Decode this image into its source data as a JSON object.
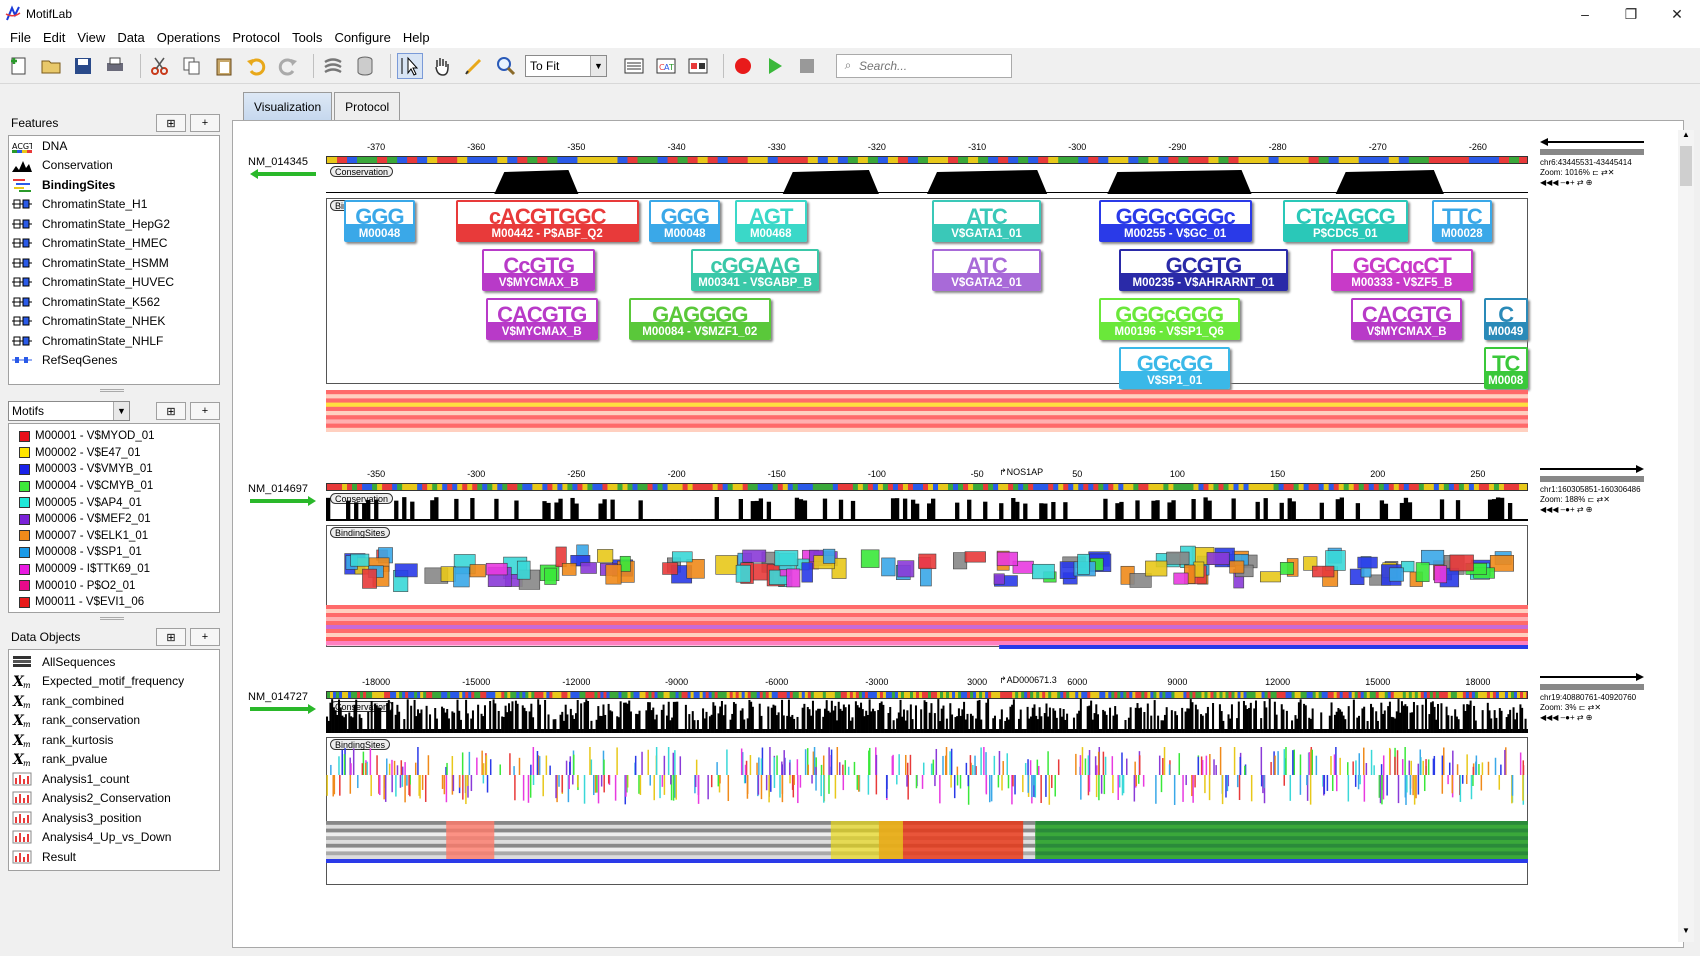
{
  "window": {
    "title": "MotifLab",
    "controls": [
      "–",
      "❐",
      "✕"
    ]
  },
  "menu": [
    "File",
    "Edit",
    "View",
    "Data",
    "Operations",
    "Protocol",
    "Tools",
    "Configure",
    "Help"
  ],
  "toolbar": {
    "zoom_value": "To Fit",
    "search_placeholder": "Search..."
  },
  "features": {
    "title": "Features",
    "items": [
      {
        "label": "DNA",
        "icon": "dna-icon",
        "bold": false
      },
      {
        "label": "Conservation",
        "icon": "conservation-icon",
        "bold": false
      },
      {
        "label": "BindingSites",
        "icon": "bindingsites-icon",
        "bold": true
      },
      {
        "label": "ChromatinState_H1",
        "icon": "region-icon",
        "bold": false
      },
      {
        "label": "ChromatinState_HepG2",
        "icon": "region-icon",
        "bold": false
      },
      {
        "label": "ChromatinState_HMEC",
        "icon": "region-icon",
        "bold": false
      },
      {
        "label": "ChromatinState_HSMM",
        "icon": "region-icon",
        "bold": false
      },
      {
        "label": "ChromatinState_HUVEC",
        "icon": "region-icon",
        "bold": false
      },
      {
        "label": "ChromatinState_K562",
        "icon": "region-icon",
        "bold": false
      },
      {
        "label": "ChromatinState_NHEK",
        "icon": "region-icon",
        "bold": false
      },
      {
        "label": "ChromatinState_NHLF",
        "icon": "region-icon",
        "bold": false
      },
      {
        "label": "RefSeqGenes",
        "icon": "genes-icon",
        "bold": false
      }
    ]
  },
  "motifs": {
    "selector": "Motifs",
    "items": [
      {
        "label": "M00001 - V$MYOD_01",
        "color": "#e8101a"
      },
      {
        "label": "M00002 - V$E47_01",
        "color": "#ffe600"
      },
      {
        "label": "M00003 - V$VMYB_01",
        "color": "#1a22e8"
      },
      {
        "label": "M00004 - V$CMYB_01",
        "color": "#3ee83a"
      },
      {
        "label": "M00005 - V$AP4_01",
        "color": "#1ee8d8"
      },
      {
        "label": "M00006 - V$MEF2_01",
        "color": "#7a22d8"
      },
      {
        "label": "M00007 - V$ELK1_01",
        "color": "#f08a1a"
      },
      {
        "label": "M00008 - V$SP1_01",
        "color": "#1a9ae8"
      },
      {
        "label": "M00009 - I$TTK69_01",
        "color": "#e81ae0"
      },
      {
        "label": "M00010 - P$O2_01",
        "color": "#e80a8a"
      },
      {
        "label": "M00011 - V$EVI1_06",
        "color": "#e81a1a"
      }
    ]
  },
  "data_objects": {
    "title": "Data Objects",
    "items": [
      {
        "label": "AllSequences",
        "icon": "collection-icon"
      },
      {
        "label": "Expected_motif_frequency",
        "icon": "numeric-map-icon"
      },
      {
        "label": "rank_combined",
        "icon": "numeric-map-icon"
      },
      {
        "label": "rank_conservation",
        "icon": "numeric-map-icon"
      },
      {
        "label": "rank_kurtosis",
        "icon": "numeric-map-icon"
      },
      {
        "label": "rank_pvalue",
        "icon": "numeric-map-icon"
      },
      {
        "label": "Analysis1_count",
        "icon": "analysis-icon"
      },
      {
        "label": "Analysis2_Conservation",
        "icon": "analysis-icon"
      },
      {
        "label": "Analysis3_position",
        "icon": "analysis-icon"
      },
      {
        "label": "Analysis4_Up_vs_Down",
        "icon": "analysis-icon"
      },
      {
        "label": "Result",
        "icon": "analysis-icon"
      }
    ]
  },
  "tabs": [
    {
      "label": "Visualization",
      "active": true
    },
    {
      "label": "Protocol",
      "active": false
    }
  ],
  "sequences": [
    {
      "name": "NM_014345",
      "ruler": [
        "-370",
        "-360",
        "-350",
        "-340",
        "-330",
        "-320",
        "-310",
        "-300",
        "-290",
        "-280",
        "-270",
        "-260"
      ],
      "info": [
        "chr6:43445531-43445414",
        "Zoom:  1016%",
        "Zoom:",
        "1016%"
      ],
      "motifs": [
        {
          "label": "M00048",
          "logo": "GGG",
          "color": "#3aa8e8",
          "row": 0,
          "start": 0.015,
          "end": 0.074
        },
        {
          "label": "M00442 - P$ABF_Q2",
          "logo": "cACGTGGC",
          "color": "#e83a3a",
          "row": 0,
          "start": 0.108,
          "end": 0.26
        },
        {
          "label": "M00048",
          "logo": "GGG",
          "color": "#3aa8e8",
          "row": 0,
          "start": 0.269,
          "end": 0.328
        },
        {
          "label": "M00468",
          "logo": "AGT",
          "color": "#3ad8c8",
          "row": 0,
          "start": 0.34,
          "end": 0.4
        },
        {
          "label": "V$GATA1_01",
          "logo": "ATC",
          "color": "#3ac8b8",
          "row": 0,
          "start": 0.504,
          "end": 0.595
        },
        {
          "label": "M00255 - V$GC_01",
          "logo": "GGGcGGGc",
          "color": "#2a3ae8",
          "row": 0,
          "start": 0.643,
          "end": 0.77
        },
        {
          "label": "P$CDC5_01",
          "logo": "CTcAGCG",
          "color": "#2ac8b8",
          "row": 0,
          "start": 0.796,
          "end": 0.9
        },
        {
          "label": "M00028",
          "logo": "TTC",
          "color": "#3aa8e8",
          "row": 0,
          "start": 0.92,
          "end": 0.97
        },
        {
          "label": "V$MYCMAX_B",
          "logo": "CcGTG",
          "color": "#b83ac8",
          "row": 1,
          "start": 0.13,
          "end": 0.224
        },
        {
          "label": "M00341 - V$GABP_B",
          "logo": "cGGAAG",
          "color": "#3ac8a8",
          "row": 1,
          "start": 0.304,
          "end": 0.41
        },
        {
          "label": "V$GATA2_01",
          "logo": "ATC",
          "color": "#a86ad8",
          "row": 1,
          "start": 0.504,
          "end": 0.595
        },
        {
          "label": "M00235 - V$AHRARNT_01",
          "logo": "GCGTG",
          "color": "#2a2aa8",
          "row": 1,
          "start": 0.66,
          "end": 0.8
        },
        {
          "label": "M00333 - V$ZF5_B",
          "logo": "GGCgcCT",
          "color": "#c83ac8",
          "row": 1,
          "start": 0.836,
          "end": 0.954
        },
        {
          "label": "V$MYCMAX_B",
          "logo": "CACGTG",
          "color": "#b83ac8",
          "row": 2,
          "start": 0.133,
          "end": 0.226
        },
        {
          "label": "M00084 - V$MZF1_02",
          "logo": "GAGGGG",
          "color": "#5ac83a",
          "row": 2,
          "start": 0.252,
          "end": 0.37
        },
        {
          "label": "M00196 - V$SP1_Q6",
          "logo": "GGGcGGG",
          "color": "#6ae83a",
          "row": 2,
          "start": 0.643,
          "end": 0.76
        },
        {
          "label": "V$MYCMAX_B",
          "logo": "CACGTG",
          "color": "#b83ac8",
          "row": 2,
          "start": 0.853,
          "end": 0.945
        },
        {
          "label": "M0049",
          "logo": "C",
          "color": "#2a8ab8",
          "row": 2,
          "start": 0.963,
          "end": 1.0
        },
        {
          "label": "V$SP1_01",
          "logo": "GGcGG",
          "color": "#3ab8e8",
          "row": 3,
          "start": 0.66,
          "end": 0.752
        },
        {
          "label": "M0008",
          "logo": "TC",
          "color": "#3ac83a",
          "row": 3,
          "start": 0.963,
          "end": 1.0
        }
      ]
    },
    {
      "name": "NM_014697",
      "ruler": [
        "-350",
        "-300",
        "-250",
        "-200",
        "-150",
        "-100",
        "-50",
        "50",
        "100",
        "150",
        "200",
        "250"
      ],
      "tss": "NOS1AP",
      "info": [
        "chr1:160305851-160306486",
        "Zoom:  188%",
        "Zoom:",
        "188%"
      ]
    },
    {
      "name": "NM_014727",
      "ruler": [
        "-18000",
        "-15000",
        "-12000",
        "-9000",
        "-6000",
        "-3000",
        "3000",
        "6000",
        "9000",
        "12000",
        "15000",
        "18000"
      ],
      "tss": "AD000671.3",
      "info": [
        "chr19:40880761-40920760",
        "Zoom:  3%",
        "Zoom:",
        "3%"
      ]
    }
  ],
  "track_labels": {
    "conservation": "Conservation",
    "binding": "BindingSites"
  },
  "colors": {
    "accent": "#c6d8ee",
    "arrow": "#22aa22"
  }
}
